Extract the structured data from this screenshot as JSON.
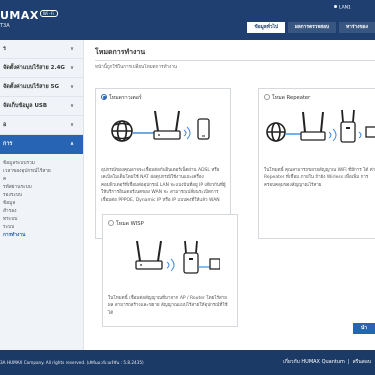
{
  "header": {
    "logo_text": "UMAX",
    "logo_badge": "Wi-Fi",
    "model": "T3A",
    "lan_status": "LAN1",
    "nav": [
      {
        "label": "ข้อมูลทั่วไป"
      },
      {
        "label": "ผลการตรวจสอบ"
      },
      {
        "label": "หาร่างของ"
      }
    ]
  },
  "sidebar": {
    "items": [
      {
        "label": "ร"
      },
      {
        "label": "จัดตั้งค่าแบบไร้สาย 2.4G"
      },
      {
        "label": "จัดตั้งค่าแบบไร้สาย 5G"
      },
      {
        "label": "จัดเก็บข้อมูล USB"
      },
      {
        "label": "อ"
      },
      {
        "label": "การ"
      }
    ],
    "sub_items": [
      {
        "label": "ข้อมูลระบบรวม"
      },
      {
        "label": "เวลาของอุปกรณ์ไร้สาย"
      },
      {
        "label": "ค"
      },
      {
        "label": "รหัสผ่านระบบ"
      },
      {
        "label": "รองระบบ"
      },
      {
        "label": "ข้อมูล"
      },
      {
        "label": "สำรอง"
      },
      {
        "label": "ทระบบ"
      },
      {
        "label": "ระบบ"
      },
      {
        "label": "การทำงาน"
      }
    ]
  },
  "main": {
    "title": "โหมดการทำงาน",
    "description": "หน้านี้ถูกใช้ในการเปลี่ยนโหมดการทำงาน",
    "cards": [
      {
        "label": "โหมดราวเตอร์",
        "selected": true,
        "description": "อุปกรณ์ของคุณอาจจะเชื่อมต่อกับอินเตอร์เน็ตผ่าน ADSL หรือ เคเบิลโมเด็มโดยใช้ NAT ผ่อตุปกรณีใช้งานแยะเครื่อง คอมพิวเตอร์ที่เชื่อมต่ออุปกรณ์ LAN จะแบ่งปันที่อยู่ IP เดียวกันที่ผู้ให้บริการอินเตอร์เนตของ WAN จะ สามารถเปลี่ยนระเบิดการเชื่อมต่อ PPPOE, Dynamic IP หรือ IP แบบคงที่ให้แล้ว WAN"
      },
      {
        "label": "โหมด Repeater",
        "selected": false,
        "description": "ในโหมดนี้ คุณสามารถขยายสัญญาณ WiFi ที่มีการ ได้ ค่า Repeater ที่เชื่อม ภายใน ถ้ายัง Wirless เพื่อเพิ่ม การครอบคลุมของสัญญาณไร้สาย"
      },
      {
        "label": "โหมด WISP",
        "selected": false,
        "description": "ในโหมดนี้ เชื่อมต่อสัญญาณที่มาจาก AP / Router โดยไร้สาย ผล สามารถสร้างและขยาย สัญญาณแบบไร้สายให้อุปกรณ์ที่ใช้ ได้"
      }
    ],
    "apply_label": "นำ"
  },
  "footer": {
    "copyright": "3A HUMAX Company. All rights reserved. (เฟิร์มแวร์เวอร์ชัน : 5.8.2435)",
    "links": [
      "เกี่ยวกับ HUMAX Quantum",
      "|",
      "สรีนสอบ"
    ]
  },
  "colors": {
    "header": "#1e3f70",
    "accent": "#2864b4",
    "sidebar_bg": "#f0f3f7",
    "footer": "#1c3a66"
  },
  "icons": [
    "globe-icon",
    "router-icon",
    "phone-icon",
    "repeater-icon",
    "laptop-icon",
    "radio-icon",
    "chevron-icon"
  ]
}
